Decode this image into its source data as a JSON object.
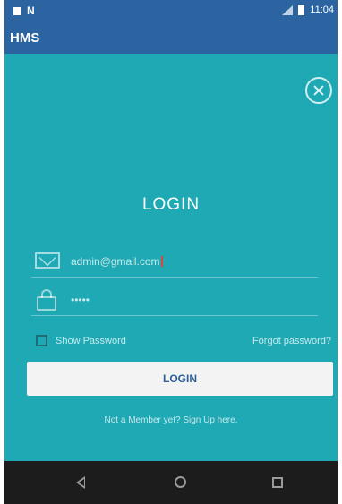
{
  "status_bar": {
    "left_icon_1": "notification-square-icon",
    "left_icon_2": "n-notification-icon",
    "left_icon_2_glyph": "N",
    "signal_icon": "signal-icon",
    "battery_icon": "battery-icon",
    "time": "11:04"
  },
  "app_bar": {
    "title": "HMS"
  },
  "close_icon": "close-icon",
  "login_form": {
    "title": "LOGIN",
    "email_icon": "mail-icon",
    "email_value": "admin@gmail.com",
    "password_icon": "lock-icon",
    "password_value": "•••••",
    "show_password_label": "Show Password",
    "show_password_checked": false,
    "forgot_password_label": "Forgot password?",
    "login_button_label": "LOGIN",
    "signup_text": "Not a Member yet? Sign Up here."
  },
  "nav_bar": {
    "back_icon": "back-triangle-icon",
    "home_icon": "home-circle-icon",
    "recents_icon": "recents-square-icon"
  },
  "colors": {
    "app_bar": "#2b64a0",
    "background": "#1fa9b4",
    "button": "#f3f3f3",
    "button_text": "#2b5f98",
    "nav_bar": "#1c1c1c"
  }
}
